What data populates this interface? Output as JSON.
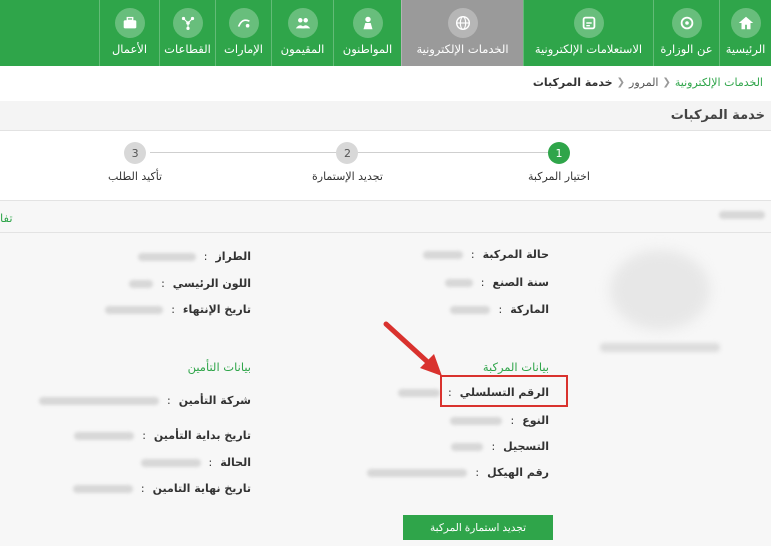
{
  "nav": {
    "items": [
      {
        "label": "الرئيسية",
        "icon": "home-icon"
      },
      {
        "label": "عن الوزارة",
        "icon": "emblem-icon"
      },
      {
        "label": "الاستعلامات الإلكترونية",
        "icon": "inquiry-icon"
      },
      {
        "label": "الخدمات الإلكترونية",
        "icon": "globe-icon",
        "active": true
      },
      {
        "label": "المواطنون",
        "icon": "citizen-icon"
      },
      {
        "label": "المقيمون",
        "icon": "residents-icon"
      },
      {
        "label": "الإمارات",
        "icon": "emirates-icon"
      },
      {
        "label": "القطاعات",
        "icon": "sectors-icon"
      },
      {
        "label": "الأعمال",
        "icon": "briefcase-icon"
      }
    ]
  },
  "breadcrumb": {
    "root": "الخدمات الإلكترونية",
    "middle": "المرور",
    "current": "خدمة المركبات"
  },
  "page": {
    "title": "خدمة المركبات"
  },
  "stepper": {
    "steps": [
      {
        "num": "1",
        "label": "اختيار المركبة",
        "active": true
      },
      {
        "num": "2",
        "label": "تجديد الإستمارة"
      },
      {
        "num": "3",
        "label": "تأكيد الطلب"
      }
    ]
  },
  "card": {
    "left_edge_title": "تفا"
  },
  "vehicle_summary": {
    "status_label": "حالة المركبة",
    "year_label": "سنة الصنع",
    "brand_label": "الماركة",
    "model_label": "الطراز",
    "color_label": "اللون الرئيسي",
    "expiry_label": "تاريخ الإنتهاء"
  },
  "vehicle_data": {
    "title": "بيانات المركبة",
    "serial_label": "الرقم التسلسلي",
    "type_label": "النوع",
    "registration_label": "التسجيل",
    "chassis_label": "رقم الهيكل"
  },
  "insurance_data": {
    "title": "بيانات التأمين",
    "company_label": "شركة التأمين",
    "start_label": "تاريخ بداية التأمين",
    "state_label": "الحالة",
    "end_label": "تاريخ نهاية التامين"
  },
  "colon": ":",
  "action": {
    "renew_button": "تجديد استمارة المركبة"
  },
  "colors": {
    "brand_green": "#2fa54a",
    "highlight_red": "#d9322e",
    "active_tab": "#9a9a9a"
  }
}
